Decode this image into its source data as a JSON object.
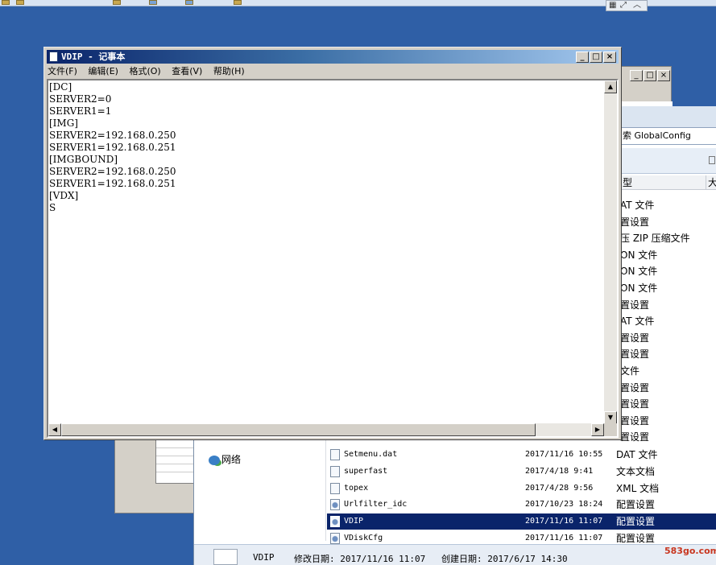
{
  "notepad": {
    "title": "VDIP - 记事本",
    "menu": [
      "文件(F)",
      "编辑(E)",
      "格式(O)",
      "查看(V)",
      "帮助(H)"
    ],
    "content": "[DC]\nSERVER2=0\nSERVER1=1\n[IMG]\nSERVER2=192.168.0.250\nSERVER1=192.168.0.251\n[IMGBOUND]\nSERVER2=192.168.0.250\nSERVER1=192.168.0.251\n[VDX]\nS",
    "minimize": "_",
    "maximize": "□",
    "close": "×"
  },
  "bg_window": {
    "minimize": "_",
    "maximize": "□",
    "close": "×"
  },
  "explorer": {
    "search_text": "索 GlobalConfig",
    "column_type": "型",
    "column_size": "大",
    "type_list": [
      "AT 文件",
      "置设置",
      "压 ZIP 压缩文件",
      "ON 文件",
      "ON 文件",
      "ON 文件",
      "置设置",
      "AT 文件",
      "置设置",
      "置设置",
      "文件",
      "置设置",
      "置设置",
      "置设置",
      "置设置"
    ],
    "nav_network": "网络",
    "files": [
      {
        "name": "Setmenu.dat",
        "date": "2017/11/16 10:55",
        "type": "DAT 文件",
        "icon": "file-icon"
      },
      {
        "name": "superfast",
        "date": "2017/4/18 9:41",
        "type": "文本文档",
        "icon": "file-icon"
      },
      {
        "name": "topex",
        "date": "2017/4/28 9:56",
        "type": "XML 文档",
        "icon": "xml-icon"
      },
      {
        "name": "Urlfilter_idc",
        "date": "2017/10/23 18:24",
        "type": "配置设置",
        "icon": "config-icon"
      },
      {
        "name": "VDIP",
        "date": "2017/11/16 11:07",
        "type": "配置设置",
        "icon": "config-icon"
      },
      {
        "name": "VDiskCfg",
        "date": "2017/11/16 11:07",
        "type": "配置设置",
        "icon": "config-icon"
      }
    ],
    "detail": {
      "name": "VDIP",
      "modified": "修改日期: 2017/11/16 11:07",
      "created": "创建日期: 2017/6/17 14:30"
    }
  },
  "watermark": "583go.com",
  "colors": {
    "selection": "#0a246a",
    "desktop": "#2f5fa6",
    "title_gradient_start": "#0a246a"
  }
}
